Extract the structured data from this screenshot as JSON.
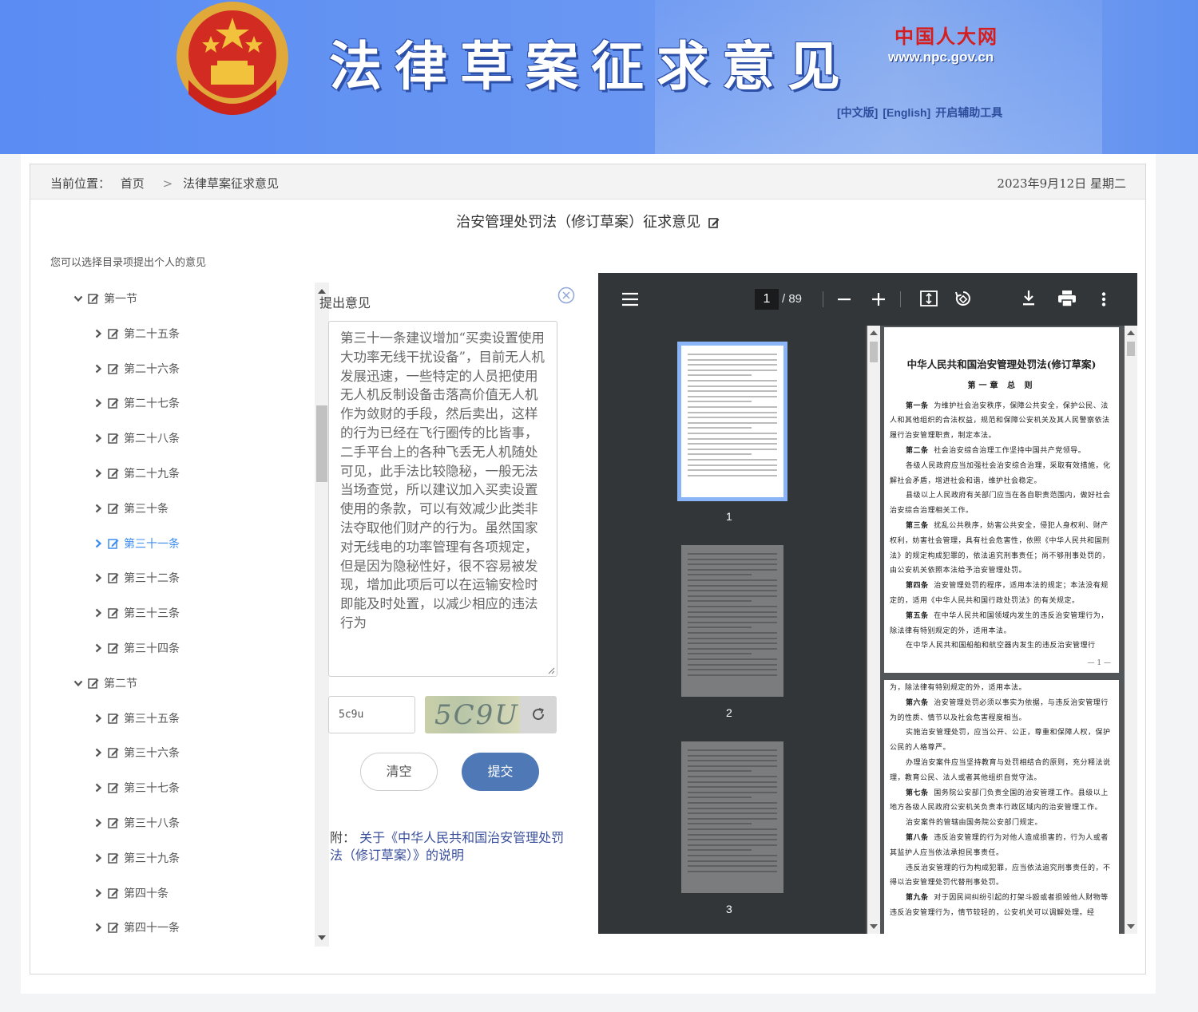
{
  "header": {
    "banner_title": "法律草案征求意见",
    "npc_logo": "中国人大网",
    "npc_url": "www.npc.gov.cn",
    "lang_links": [
      "[中文版]",
      "[English]",
      "开启辅助工具"
    ]
  },
  "breadcrumb": {
    "prefix": "当前位置：",
    "home": "首页",
    "separator": ">",
    "current": "法律草案征求意见",
    "date": "2023年9月12日 星期二"
  },
  "doc_title": "治安管理处罚法（修订草案）征求意见",
  "hint": "您可以选择目录项提出个人的意见",
  "tree": [
    {
      "label": "第一节",
      "level": 1,
      "expanded": true
    },
    {
      "label": "第二十五条",
      "level": 2
    },
    {
      "label": "第二十六条",
      "level": 2
    },
    {
      "label": "第二十七条",
      "level": 2
    },
    {
      "label": "第二十八条",
      "level": 2
    },
    {
      "label": "第二十九条",
      "level": 2
    },
    {
      "label": "第三十条",
      "level": 2
    },
    {
      "label": "第三十一条",
      "level": 2,
      "active": true
    },
    {
      "label": "第三十二条",
      "level": 2
    },
    {
      "label": "第三十三条",
      "level": 2
    },
    {
      "label": "第三十四条",
      "level": 2
    },
    {
      "label": "第二节",
      "level": 1,
      "expanded": true
    },
    {
      "label": "第三十五条",
      "level": 2
    },
    {
      "label": "第三十六条",
      "level": 2
    },
    {
      "label": "第三十七条",
      "level": 2
    },
    {
      "label": "第三十八条",
      "level": 2
    },
    {
      "label": "第三十九条",
      "level": 2
    },
    {
      "label": "第四十条",
      "level": 2
    },
    {
      "label": "第四十一条",
      "level": 2
    }
  ],
  "comment": {
    "heading": "提出意见",
    "text": "第三十一条建议增加“买卖设置使用大功率无线干扰设备”，目前无人机发展迅速，一些特定的人员把使用无人机反制设备击落高价值无人机作为敛财的手段，然后卖出，这样的行为已经在飞行圈传的比皆事，二手平台上的各种飞丢无人机随处可见，此手法比较隐秘，一般无法当场查觉，所以建议加入买卖设置使用的条款，可以有效减少此类非法夺取他们财产的行为。虽然国家对无线电的功率管理有各项规定，但是因为隐秘性好，很不容易被发现，增加此项后可以在运输安检时即能及时处置，以减少相应的违法行为",
    "captcha_value": "5c9u",
    "captcha_image_text": "5C9U",
    "clear_label": "清空",
    "submit_label": "提交",
    "attach_prefix": "附：",
    "attach_link": "关于《中华人民共和国治安管理处罚法（修订草案）》的说明"
  },
  "pdf": {
    "current_page": "1",
    "total_pages": "/ 89",
    "thumb_labels": [
      "1",
      "2",
      "3"
    ],
    "page1": {
      "title": "中华人民共和国治安管理处罚法(修订草案)",
      "chapter": "第一章 总 则",
      "paras": [
        {
          "b": "第一条",
          "t": "为维护社会治安秩序，保障公共安全，保护公民、法人和其他组织的合法权益，规范和保障公安机关及其人民警察依法履行治安管理职责，制定本法。"
        },
        {
          "b": "第二条",
          "t": "社会治安综合治理工作坚持中国共产党领导。"
        },
        {
          "b": "",
          "t": "各级人民政府应当加强社会治安综合治理，采取有效措施，化解社会矛盾，增进社会和谐，维护社会稳定。"
        },
        {
          "b": "",
          "t": "县级以上人民政府有关部门应当在各自职责范围内，做好社会治安综合治理相关工作。"
        },
        {
          "b": "第三条",
          "t": "扰乱公共秩序，妨害公共安全，侵犯人身权利、财产权利，妨害社会管理，具有社会危害性，依照《中华人民共和国刑法》的规定构成犯罪的，依法追究刑事责任；尚不够刑事处罚的，由公安机关依照本法给予治安管理处罚。"
        },
        {
          "b": "第四条",
          "t": "治安管理处罚的程序，适用本法的规定；本法没有规定的，适用《中华人民共和国行政处罚法》的有关规定。"
        },
        {
          "b": "第五条",
          "t": "在中华人民共和国领域内发生的违反治安管理行为，除法律有特别规定的外，适用本法。"
        },
        {
          "b": "",
          "t": "在中华人民共和国船舶和航空器内发生的违反治安管理行"
        }
      ],
      "page_no": "— 1 —"
    },
    "page2": {
      "paras": [
        {
          "b": "",
          "t": "为，除法律有特别规定的外，适用本法。"
        },
        {
          "b": "第六条",
          "t": "治安管理处罚必须以事实为依据，与违反治安管理行为的性质、情节以及社会危害程度相当。"
        },
        {
          "b": "",
          "t": "实施治安管理处罚，应当公开、公正，尊重和保障人权，保护公民的人格尊严。"
        },
        {
          "b": "",
          "t": "办理治安案件应当坚持教育与处罚相结合的原则，充分释法说理，教育公民、法人或者其他组织自觉守法。"
        },
        {
          "b": "第七条",
          "t": "国务院公安部门负责全国的治安管理工作。县级以上地方各级人民政府公安机关负责本行政区域内的治安管理工作。"
        },
        {
          "b": "",
          "t": "治安案件的管辖由国务院公安部门规定。"
        },
        {
          "b": "第八条",
          "t": "违反治安管理的行为对他人造成损害的，行为人或者其监护人应当依法承担民事责任。"
        },
        {
          "b": "",
          "t": "违反治安管理的行为构成犯罪，应当依法追究刑事责任的，不得以治安管理处罚代替刑事处罚。"
        },
        {
          "b": "第九条",
          "t": "对于因民间纠纷引起的打架斗殴或者损毁他人财物等违反治安管理行为，情节较轻的，公安机关可以调解处理。经"
        }
      ]
    }
  }
}
